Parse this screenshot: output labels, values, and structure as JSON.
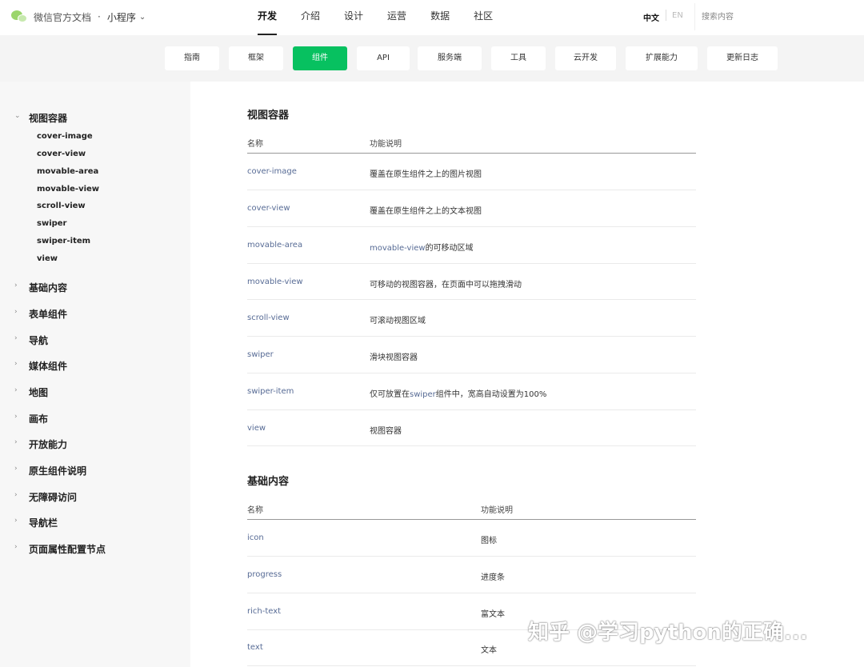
{
  "header": {
    "site_title": "微信官方文档",
    "separator": "·",
    "product": "小程序",
    "nav": [
      "开发",
      "介绍",
      "设计",
      "运营",
      "数据",
      "社区"
    ],
    "active_nav": "开发",
    "lang_zh": "中文",
    "lang_en": "EN",
    "search_placeholder": "搜索内容"
  },
  "subnav": {
    "tabs": [
      "指南",
      "框架",
      "组件",
      "API",
      "服务端",
      "工具",
      "云开发",
      "扩展能力",
      "更新日志"
    ],
    "active": "组件"
  },
  "sidebar": {
    "expanded_group": "视图容器",
    "expanded_items": [
      "cover-image",
      "cover-view",
      "movable-area",
      "movable-view",
      "scroll-view",
      "swiper",
      "swiper-item",
      "view"
    ],
    "groups": [
      "基础内容",
      "表单组件",
      "导航",
      "媒体组件",
      "地图",
      "画布",
      "开放能力",
      "原生组件说明",
      "无障碍访问",
      "导航栏",
      "页面属性配置节点"
    ]
  },
  "sections": [
    {
      "title": "视图容器",
      "headers": [
        "名称",
        "功能说明"
      ],
      "rows": [
        {
          "name": "cover-image",
          "desc_link": "",
          "desc": "覆盖在原生组件之上的图片视图",
          "desc_tail": ""
        },
        {
          "name": "cover-view",
          "desc_link": "",
          "desc": "覆盖在原生组件之上的文本视图",
          "desc_tail": ""
        },
        {
          "name": "movable-area",
          "desc_link": "movable-view",
          "desc": "的可移动区域",
          "desc_tail": ""
        },
        {
          "name": "movable-view",
          "desc_link": "",
          "desc": "可移动的视图容器，在页面中可以拖拽滑动",
          "desc_tail": ""
        },
        {
          "name": "scroll-view",
          "desc_link": "",
          "desc": "可滚动视图区域",
          "desc_tail": ""
        },
        {
          "name": "swiper",
          "desc_link": "",
          "desc": "滑块视图容器",
          "desc_tail": ""
        },
        {
          "name": "swiper-item",
          "desc_link": "swiper",
          "desc": "仅可放置在",
          "desc_tail": "组件中，宽高自动设置为100%"
        },
        {
          "name": "view",
          "desc_link": "",
          "desc": "视图容器",
          "desc_tail": ""
        }
      ]
    },
    {
      "title": "基础内容",
      "headers": [
        "名称",
        "功能说明"
      ],
      "rows": [
        {
          "name": "icon",
          "desc": "图标"
        },
        {
          "name": "progress",
          "desc": "进度条"
        },
        {
          "name": "rich-text",
          "desc": "富文本"
        },
        {
          "name": "text",
          "desc": "文本"
        }
      ]
    }
  ],
  "watermark": "知乎 @学习python的正确...",
  "colors": {
    "accent_green": "#07c160",
    "link_blue": "#576b95",
    "sidebar_bg": "#f7f7f7",
    "subnav_bg": "#f4f4f4"
  },
  "icons": {
    "brand": "wechat-logo-icon",
    "product_dropdown": "chevron-down-icon",
    "group_expanded": "chevron-down-icon",
    "group_collapsed": "chevron-right-icon"
  }
}
